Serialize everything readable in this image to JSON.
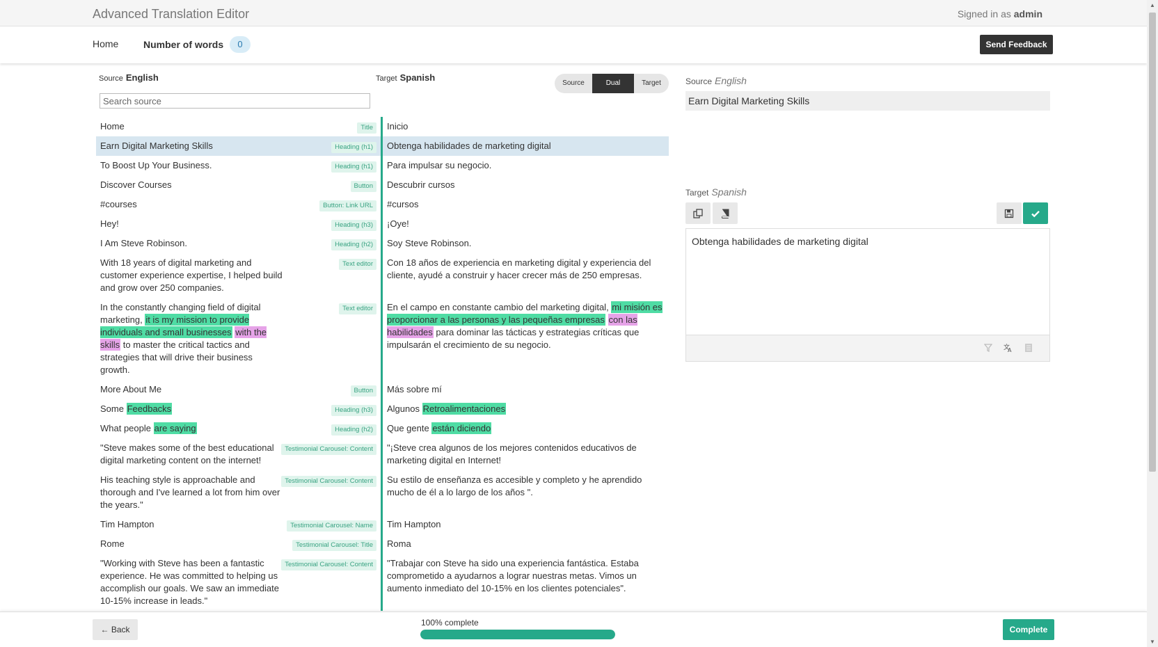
{
  "app": {
    "title": "Advanced Translation Editor",
    "signed_in_prefix": "Signed in as",
    "user": "admin"
  },
  "nav": {
    "home": "Home",
    "words_label": "Number of words",
    "words_count": "0",
    "feedback": "Send Feedback"
  },
  "left": {
    "source_label": "Source",
    "source_lang": "English",
    "target_label": "Target",
    "target_lang": "Spanish",
    "search_placeholder": "Search source",
    "view_modes": [
      "Source",
      "Dual",
      "Target"
    ],
    "active_mode": "Dual"
  },
  "rows": [
    {
      "src": "Home",
      "tag": "Title",
      "tgt": "Inicio"
    },
    {
      "src": "Earn Digital Marketing Skills",
      "tag": "Heading (h1)",
      "tgt": "Obtenga habilidades de marketing digital",
      "selected": true
    },
    {
      "src": "To Boost Up Your Business.",
      "tag": "Heading (h1)",
      "tgt": "Para impulsar su negocio."
    },
    {
      "src": "Discover Courses",
      "tag": "Button",
      "tgt": "Descubrir cursos"
    },
    {
      "src": "#courses",
      "tag": "Button: Link URL",
      "tgt": "#cursos"
    },
    {
      "src": "Hey!",
      "tag": "Heading (h3)",
      "tgt": "¡Oye!"
    },
    {
      "src": "I Am Steve Robinson.",
      "tag": "Heading (h2)",
      "tgt": "Soy Steve Robinson."
    },
    {
      "src": "With 18 years of digital marketing and customer experience expertise, I helped build and grow over 250 companies.",
      "tag": "Text editor",
      "tgt": "Con 18 años de experiencia en marketing digital y experiencia del cliente, ayudé a construir y hacer crecer más de 250 empresas."
    },
    {
      "src_parts": [
        {
          "t": "In the constantly changing field of digital marketing, "
        },
        {
          "t": "it is my mission to provide individuals and small businesses",
          "h": "g"
        },
        {
          "t": " "
        },
        {
          "t": "with the skills",
          "h": "p"
        },
        {
          "t": " to master the critical tactics and strategies that will drive their business growth."
        }
      ],
      "tag": "Text editor",
      "tgt_parts": [
        {
          "t": "En el campo en constante cambio del marketing digital, "
        },
        {
          "t": "mi misión es proporcionar a las personas y las pequeñas empresas",
          "h": "g"
        },
        {
          "t": " "
        },
        {
          "t": "con las habilidades",
          "h": "p"
        },
        {
          "t": " para dominar las tácticas y estrategias críticas que impulsarán el crecimiento de su negocio."
        }
      ]
    },
    {
      "src": "More About Me",
      "tag": "Button",
      "tgt": "Más sobre mí"
    },
    {
      "src_parts": [
        {
          "t": "Some "
        },
        {
          "t": "Feedbacks",
          "h": "g"
        }
      ],
      "tag": "Heading (h3)",
      "tgt_parts": [
        {
          "t": "Algunos "
        },
        {
          "t": "Retroalimentaciones",
          "h": "g"
        }
      ]
    },
    {
      "src_parts": [
        {
          "t": "What people "
        },
        {
          "t": "are saying",
          "h": "g"
        }
      ],
      "tag": "Heading (h2)",
      "tgt_parts": [
        {
          "t": "Que gente "
        },
        {
          "t": "están diciendo",
          "h": "g"
        }
      ]
    },
    {
      "src": "\"Steve makes some of the best educational digital marketing content on the internet!",
      "tag": "Testimonial Carousel: Content",
      "tgt": "\"¡Steve crea algunos de los mejores contenidos educativos de marketing digital en Internet!"
    },
    {
      "src": "His teaching style is approachable and thorough and I've learned a lot from him over the years.\"",
      "tag": "Testimonial Carousel: Content",
      "tgt": "Su estilo de enseñanza es accesible y completo y he aprendido mucho de él a lo largo de los años \"."
    },
    {
      "src": "Tim Hampton",
      "tag": "Testimonial Carousel: Name",
      "tgt": "Tim Hampton"
    },
    {
      "src": "Rome",
      "tag": "Testimonial Carousel: Title",
      "tgt": "Roma"
    },
    {
      "src": "\"Working with Steve has been a fantastic experience. He was committed to helping us accomplish our goals. We saw an immediate 10-15% increase in leads.\"",
      "tag": "Testimonial Carousel: Content",
      "tgt": "\"Trabajar con Steve ha sido una experiencia fantástica. Estaba comprometido a ayudarnos a lograr nuestras metas. Vimos un aumento inmediato del 10-15% en los clientes potenciales\"."
    }
  ],
  "right": {
    "source_label": "Source",
    "source_lang": "English",
    "source_text": "Earn Digital Marketing Skills",
    "target_label": "Target",
    "target_lang": "Spanish",
    "target_text": "Obtenga habilidades de marketing digital",
    "icons": [
      "copy-source-icon",
      "glossary-book-icon",
      "save-icon",
      "confirm-check-icon",
      "filter-icon",
      "translate-icon",
      "document-icon"
    ]
  },
  "footer": {
    "back": "← Back",
    "progress_label": "100% complete",
    "progress": 1.0,
    "complete": "Complete"
  },
  "colors": {
    "accent": "#26a98a",
    "highlight_green": "#4fdca4",
    "highlight_pink": "#e6a3e8",
    "selected_row": "#d7e6f0"
  }
}
